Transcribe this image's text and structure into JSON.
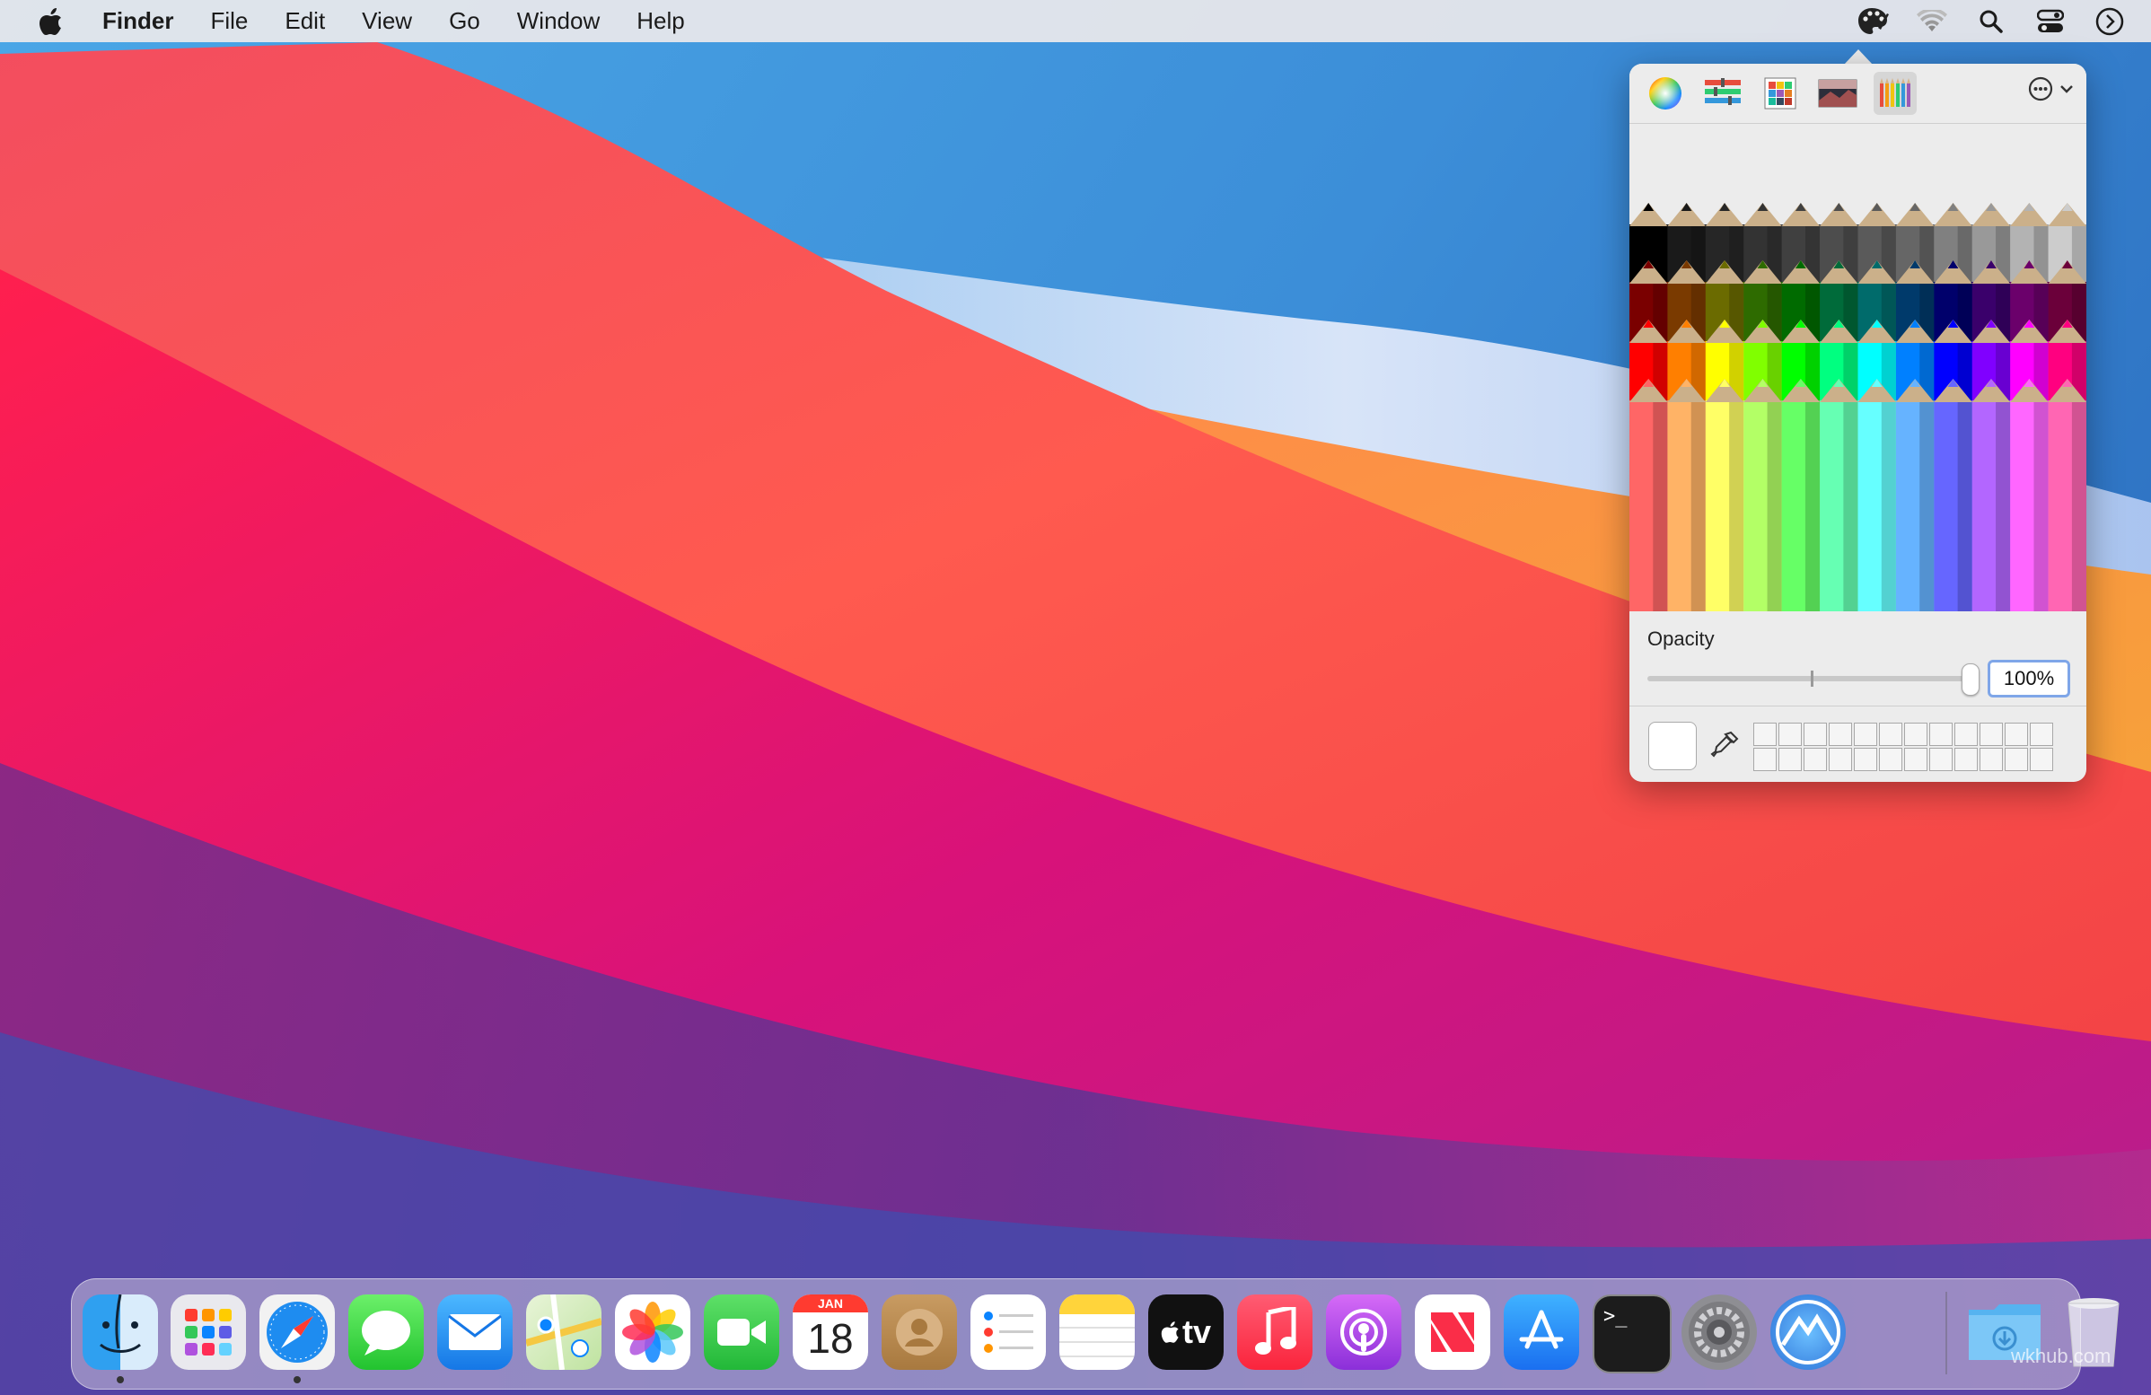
{
  "menubar": {
    "app_name": "Finder",
    "items": [
      "File",
      "Edit",
      "View",
      "Go",
      "Window",
      "Help"
    ],
    "status_icons": [
      "color-picker-icon",
      "wifi-icon",
      "search-icon",
      "control-center-icon",
      "siri-icon"
    ]
  },
  "color_panel": {
    "modes": [
      "color-wheel-icon",
      "color-sliders-icon",
      "color-palettes-icon",
      "image-palettes-icon",
      "pencils-icon"
    ],
    "selected_mode": "pencils-icon",
    "opacity_label": "Opacity",
    "opacity_value": "100%",
    "opacity_fraction": 1.0,
    "current_color": "#ffffff",
    "pencil_rows": [
      [
        "#000000",
        "#1a1a1a",
        "#262626",
        "#333333",
        "#404040",
        "#4d4d4d",
        "#5a5a5a",
        "#666666",
        "#808080",
        "#999999",
        "#b3b3b3",
        "#cccccc"
      ],
      [
        "#7a0000",
        "#7a3a00",
        "#6b6b00",
        "#2e6b00",
        "#006b00",
        "#006b3a",
        "#006b6b",
        "#003a6b",
        "#00006b",
        "#3a006b",
        "#6b006b",
        "#6b003a"
      ],
      [
        "#ff0000",
        "#ff7f00",
        "#ffff00",
        "#80ff00",
        "#00ff00",
        "#00ff80",
        "#00ffff",
        "#0080ff",
        "#0000ff",
        "#8000ff",
        "#ff00ff",
        "#ff0080"
      ],
      [
        "#ff6666",
        "#ffb366",
        "#ffff66",
        "#b3ff66",
        "#66ff66",
        "#66ffb3",
        "#66ffff",
        "#66b3ff",
        "#6666ff",
        "#b366ff",
        "#ff66ff",
        "#ff66b3"
      ]
    ]
  },
  "dock": {
    "apps": [
      {
        "name": "finder",
        "running": true
      },
      {
        "name": "launchpad",
        "running": false
      },
      {
        "name": "safari",
        "running": true
      },
      {
        "name": "messages",
        "running": false
      },
      {
        "name": "mail",
        "running": false
      },
      {
        "name": "maps",
        "running": false
      },
      {
        "name": "photos",
        "running": false
      },
      {
        "name": "facetime",
        "running": false
      },
      {
        "name": "calendar",
        "running": false
      },
      {
        "name": "contacts",
        "running": false
      },
      {
        "name": "reminders",
        "running": false
      },
      {
        "name": "notes",
        "running": false
      },
      {
        "name": "tv",
        "running": false
      },
      {
        "name": "music",
        "running": false
      },
      {
        "name": "podcasts",
        "running": false
      },
      {
        "name": "news",
        "running": false
      },
      {
        "name": "app-store",
        "running": false
      },
      {
        "name": "terminal",
        "running": false
      },
      {
        "name": "system-preferences",
        "running": false
      },
      {
        "name": "big-sur-installer",
        "running": false
      }
    ],
    "calendar_month": "JAN",
    "calendar_day": "18",
    "tv_label": "tv",
    "terminal_prompt": ">_"
  },
  "watermark": "wkhub.com"
}
